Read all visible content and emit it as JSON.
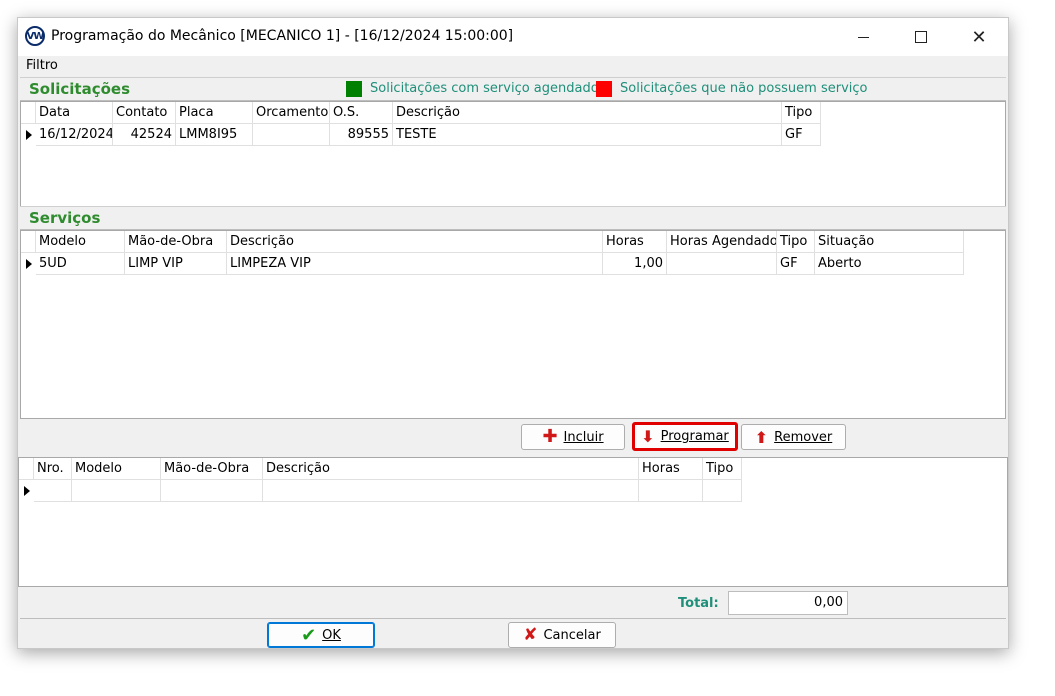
{
  "window": {
    "title": "Programação do Mecânico [MECANICO 1] - [16/12/2024 15:00:00]",
    "logo_text": "VW"
  },
  "menu": {
    "filtro": "Filtro"
  },
  "solicitacoes": {
    "title": "Solicitações",
    "legend": [
      {
        "label": "Solicitações com serviço agendado",
        "color": "#008000"
      },
      {
        "label": "Solicitações que não possuem serviço",
        "color": "#ff0000"
      }
    ],
    "columns": [
      "Data",
      "Contato",
      "Placa",
      "Orcamento",
      "O.S.",
      "Descrição",
      "Tipo"
    ],
    "rows": [
      [
        "16/12/2024",
        "42524",
        "LMM8I95",
        "",
        "89555",
        "TESTE",
        "GF"
      ]
    ]
  },
  "servicos": {
    "title": "Serviços",
    "columns": [
      "Modelo",
      "Mão-de-Obra",
      "Descrição",
      "Horas",
      "Horas Agendado",
      "Tipo",
      "Situação"
    ],
    "rows": [
      [
        "5UD",
        "LIMP VIP",
        "LIMPEZA VIP",
        "1,00",
        "",
        "GF",
        "Aberto"
      ]
    ]
  },
  "actions": {
    "incluir": "Incluir",
    "programar": "Programar",
    "remover": "Remover"
  },
  "programacao": {
    "columns": [
      "Nro.",
      "Modelo",
      "Mão-de-Obra",
      "Descrição",
      "Horas",
      "Tipo"
    ],
    "rows": [
      [
        "",
        "",
        "",
        "",
        "",
        ""
      ]
    ]
  },
  "total": {
    "label": "Total:",
    "value": "0,00"
  },
  "footer": {
    "ok": "OK",
    "cancelar": "Cancelar"
  }
}
